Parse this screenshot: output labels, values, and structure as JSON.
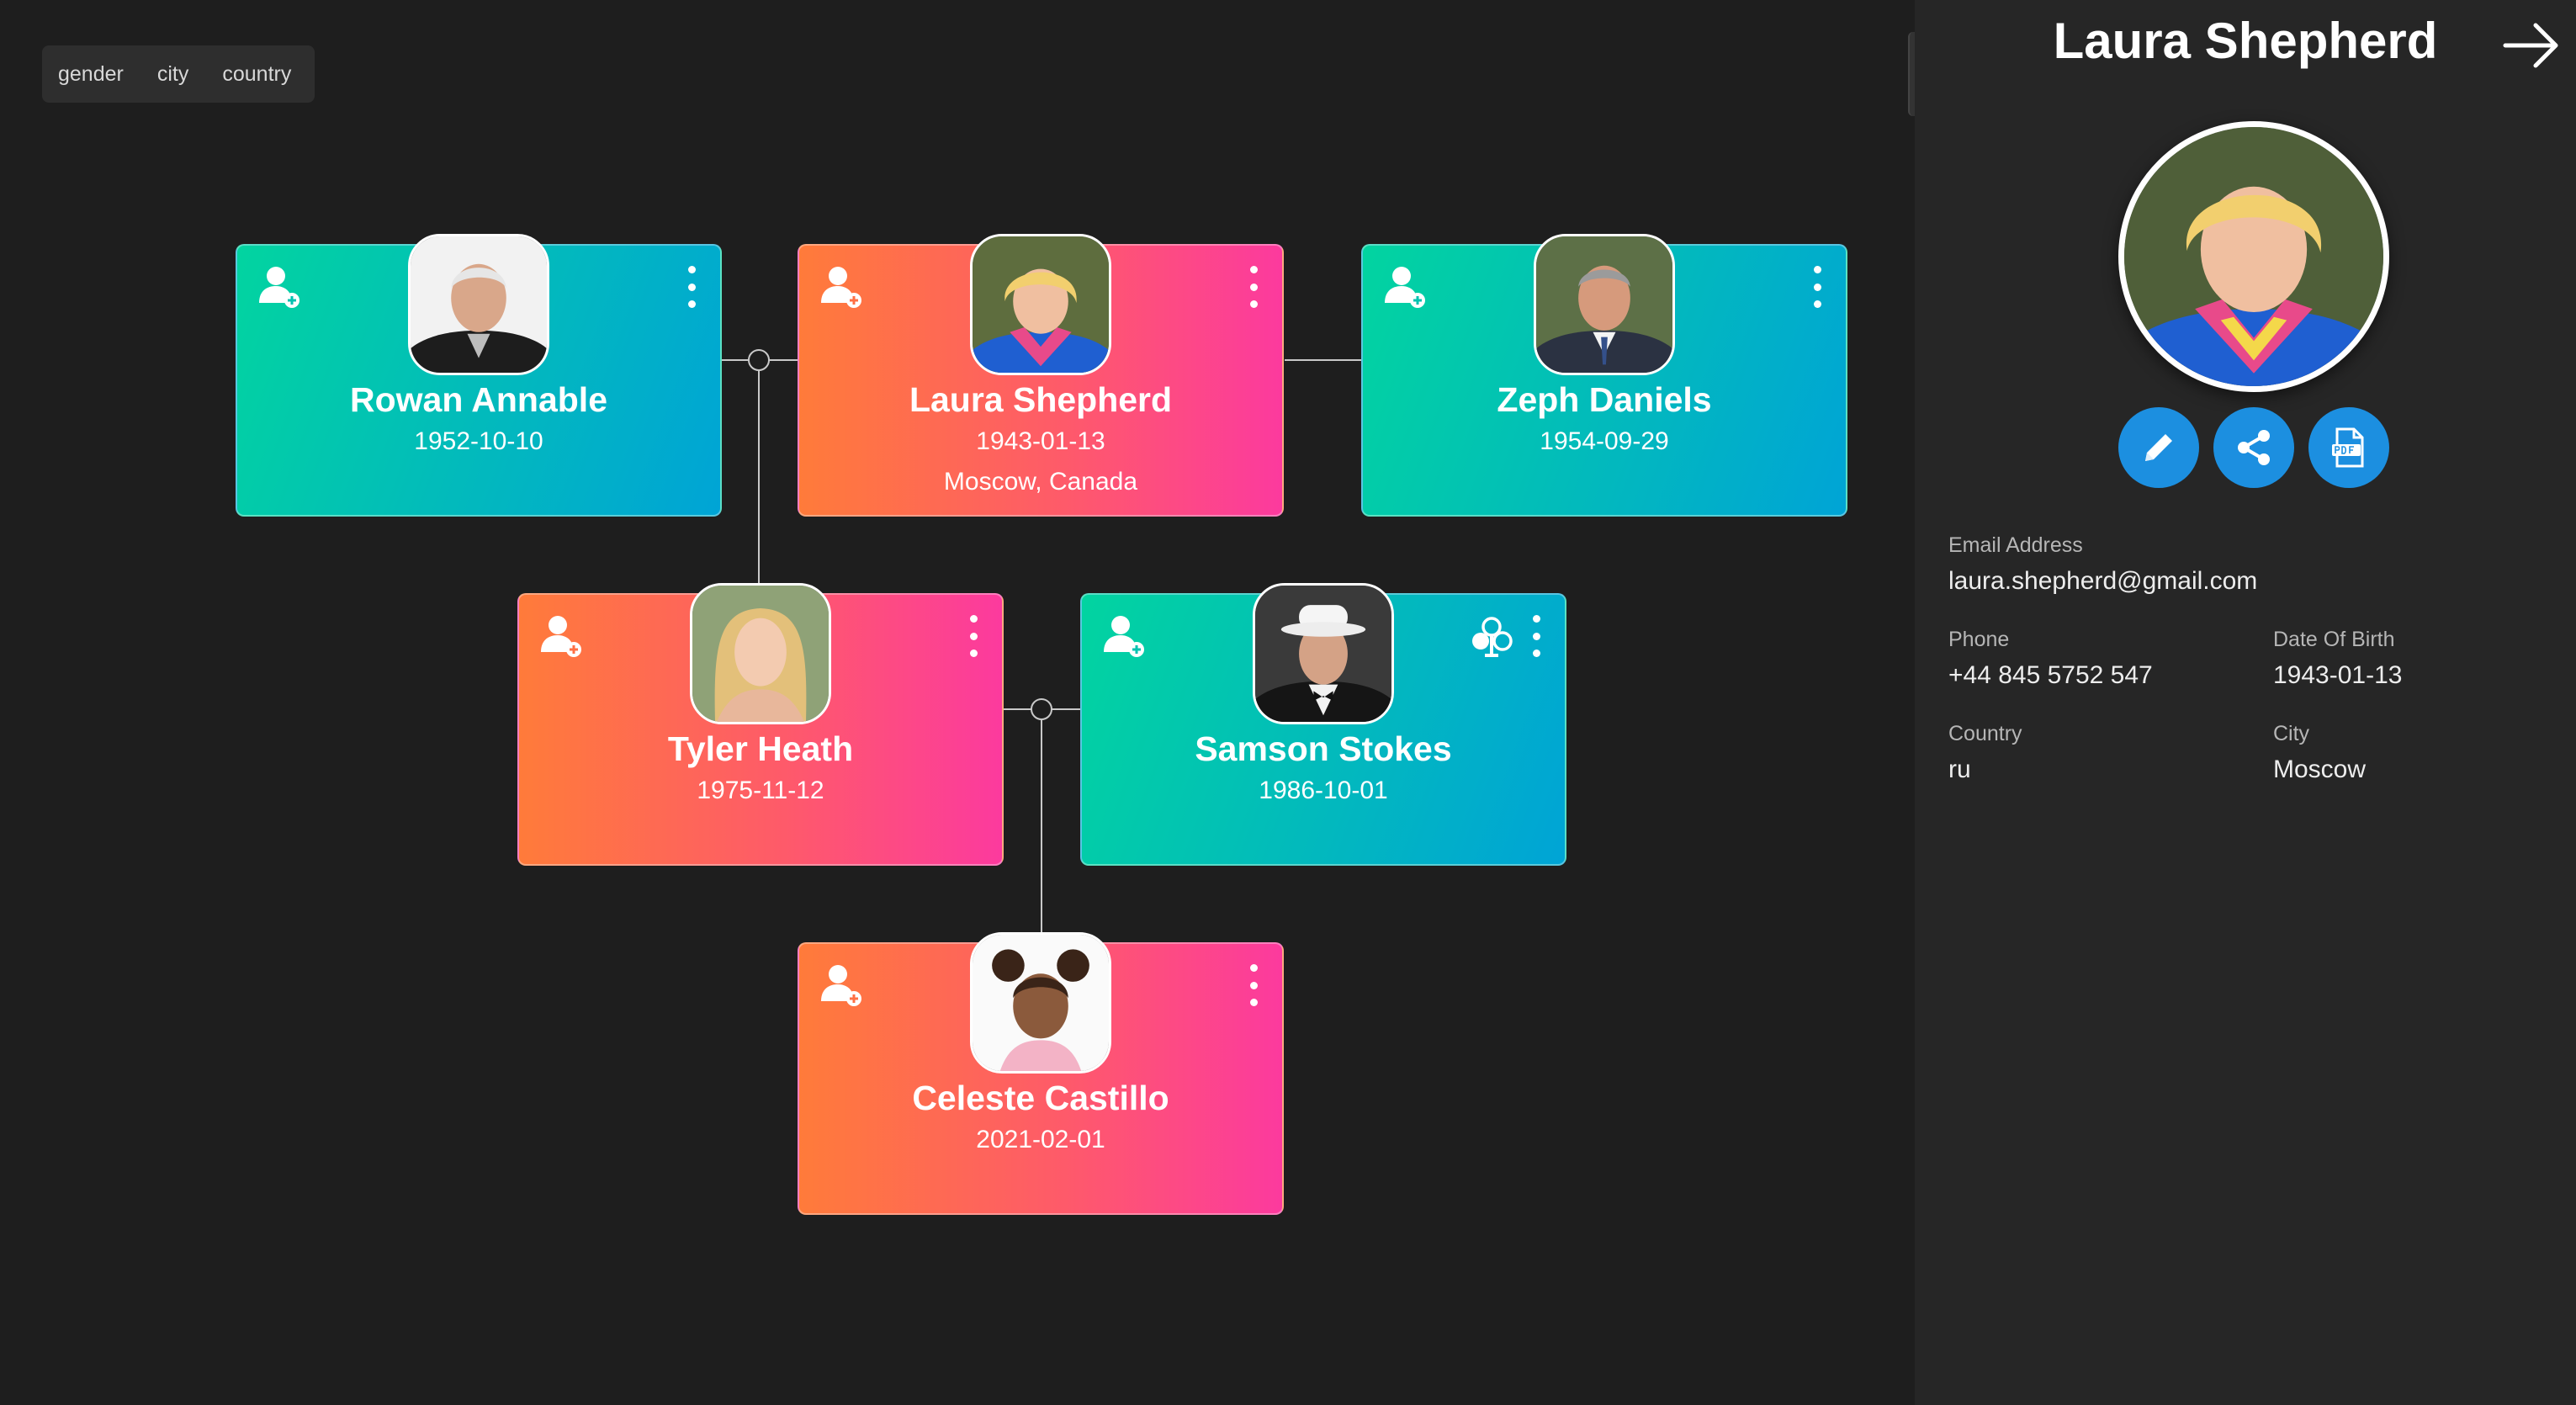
{
  "filters": [
    "gender",
    "city",
    "country"
  ],
  "cards": [
    {
      "name": "Rowan Annable",
      "dob": "1952-10-10",
      "place": "",
      "theme": "teal",
      "photo": "elderly-man-photo"
    },
    {
      "name": "Laura Shepherd",
      "dob": "1943-01-13",
      "place": "Moscow, Canada",
      "theme": "pink",
      "photo": "blonde-woman-photo"
    },
    {
      "name": "Zeph Daniels",
      "dob": "1954-09-29",
      "place": "",
      "theme": "teal",
      "photo": "man-in-suit-photo"
    },
    {
      "name": "Tyler Heath",
      "dob": "1975-11-12",
      "place": "",
      "theme": "pink",
      "photo": "young-woman-photo"
    },
    {
      "name": "Samson Stokes",
      "dob": "1986-10-01",
      "place": "",
      "theme": "teal",
      "photo": "man-in-white-hat-photo"
    },
    {
      "name": "Celeste Castillo",
      "dob": "2021-02-01",
      "place": "",
      "theme": "pink",
      "photo": "little-girl-photo"
    }
  ],
  "icons": {
    "add_user": "add-user-icon",
    "menu": "more-vertical-icon",
    "club": "club-icon",
    "close": "arrow-right-icon",
    "edit": "pencil-icon",
    "share": "share-icon",
    "pdf": "pdf-icon"
  },
  "colors": {
    "teal_start": "#02d4a0",
    "teal_end": "#00a4d6",
    "pink_start": "#ff7b3a",
    "pink_end": "#fc3a9e",
    "action_blue": "#1c8fe0",
    "background": "#1e1e1e",
    "panel": "#262626"
  },
  "panel": {
    "title": "Laura Shepherd",
    "email_label": "Email Address",
    "email": "laura.shepherd@gmail.com",
    "phone_label": "Phone",
    "phone": "+44 845 5752 547",
    "dob_label": "Date Of Birth",
    "dob": "1943-01-13",
    "country_label": "Country",
    "country": "ru",
    "city_label": "City",
    "city": "Moscow"
  }
}
